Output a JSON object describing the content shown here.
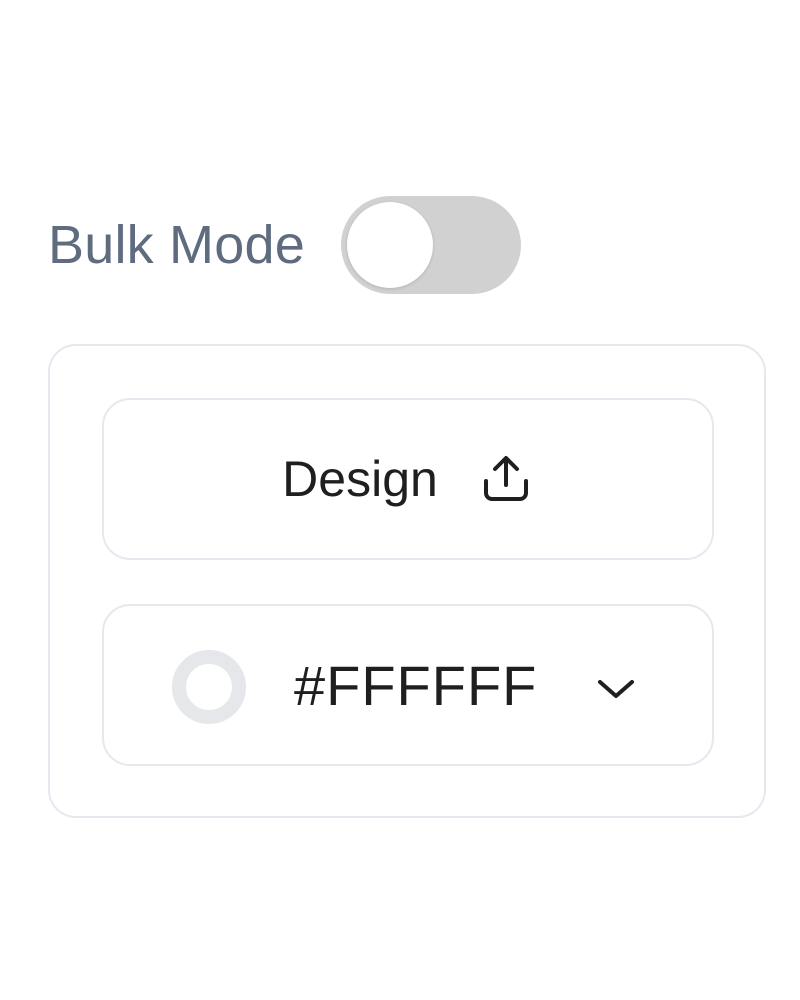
{
  "bulk_mode": {
    "label": "Bulk Mode",
    "enabled": false,
    "track_color": "#d1d1d1"
  },
  "design_button": {
    "label": "Design",
    "icon": "upload-icon"
  },
  "color_select": {
    "value": "#FFFFFF",
    "swatch_color": "#FFFFFF",
    "icon": "chevron-down-icon"
  }
}
